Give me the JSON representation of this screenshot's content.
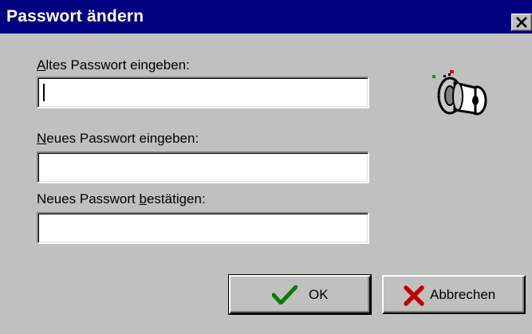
{
  "window": {
    "title": "Passwort ändern",
    "close_icon": "close-x-icon"
  },
  "form": {
    "old_password": {
      "label_pre": "",
      "label_key": "A",
      "label_post": "ltes Passwort eingeben:",
      "value": ""
    },
    "new_password": {
      "label_pre": "",
      "label_key": "N",
      "label_post": "eues Passwort eingeben:",
      "value": ""
    },
    "confirm_password": {
      "label_pre": "Neues Passwort ",
      "label_key": "b",
      "label_post": "estätigen:",
      "value": ""
    }
  },
  "illustration": {
    "icon": "key-icon"
  },
  "buttons": {
    "ok_label": "OK",
    "ok_icon": "checkmark-icon",
    "cancel_label": "Abbrechen",
    "cancel_icon": "red-x-icon"
  },
  "colors": {
    "titlebar": "#000080",
    "face": "#c0c0c0",
    "ok_check": "#008000",
    "cancel_x": "#c00000"
  }
}
